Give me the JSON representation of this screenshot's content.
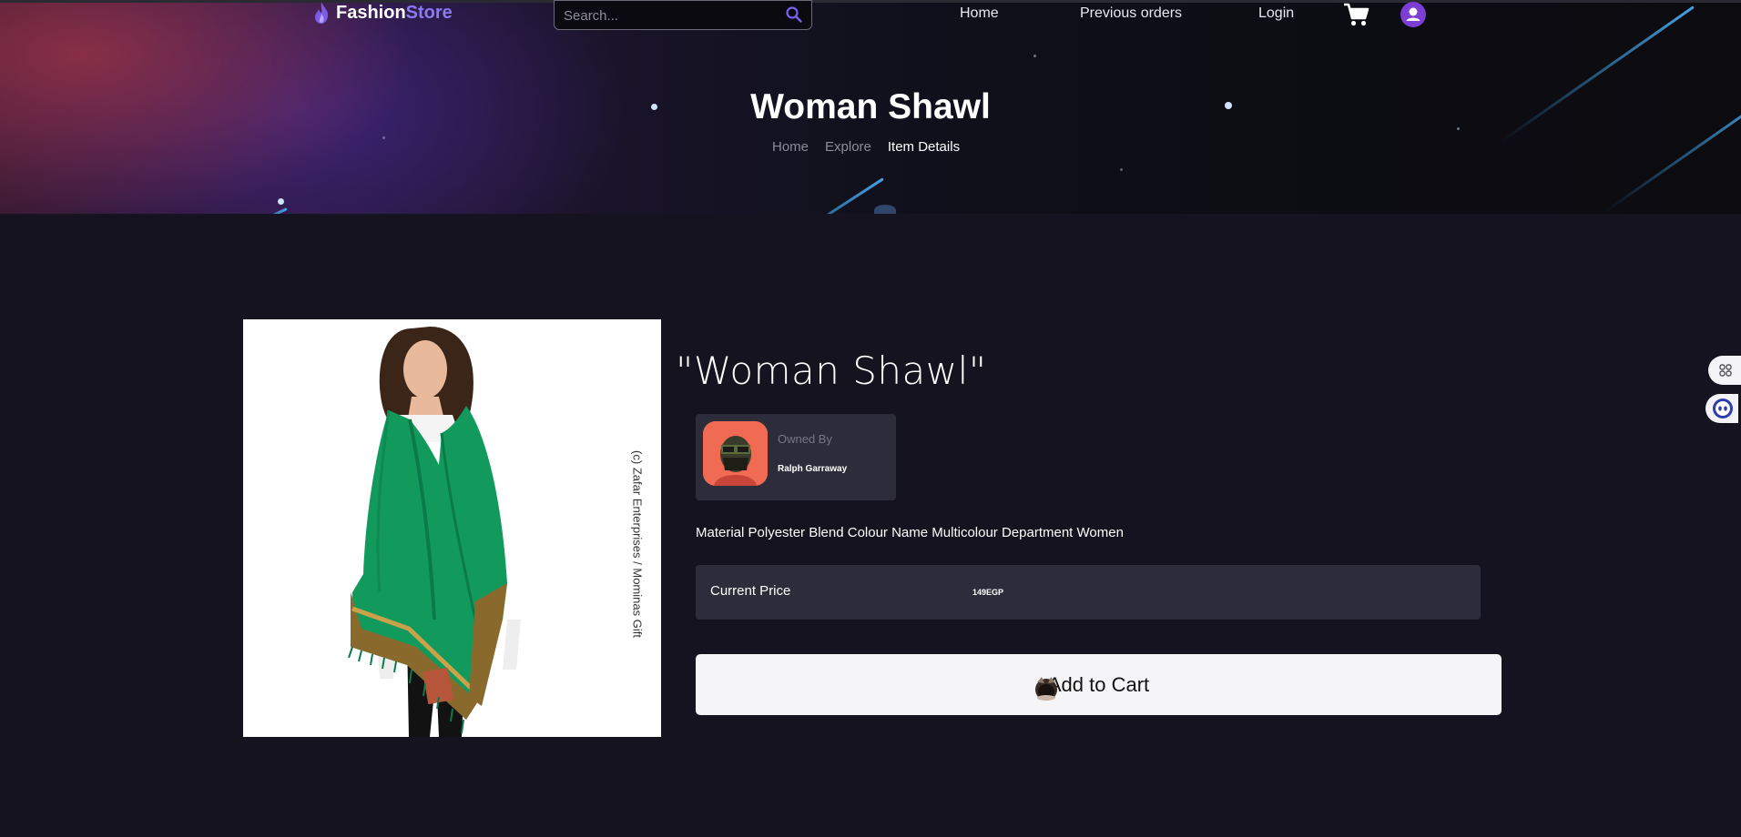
{
  "navbar": {
    "brand": {
      "part1": "Fashion",
      "part2": "Store"
    },
    "search": {
      "placeholder": "Search..."
    },
    "links": {
      "home": "Home",
      "previous_orders": "Previous orders",
      "login": "Login"
    }
  },
  "hero": {
    "title": "Woman Shawl",
    "breadcrumb": [
      "Home",
      "Explore",
      "Item Details"
    ]
  },
  "product": {
    "image_credit": "(c) Zafar Enterprises / Mominas Gift",
    "title": "\"Woman Shawl\"",
    "owner_label": "Owned By",
    "owner_name": "Ralph Garraway",
    "description": "Material Polyester Blend Colour Name Multicolour Department Women",
    "price_label": "Current Price",
    "price_value": "149EGP",
    "add_to_cart_label": "Add to Cart"
  },
  "colors": {
    "page_bg": "#14131f",
    "brand_accent": "#8a7cf0",
    "card_bg": "#2d2c3a",
    "shawl_green": "#129a5c",
    "avatar_purple": "#7d3ed6"
  },
  "icons": [
    "flame-icon",
    "search-icon",
    "cart-icon",
    "user-avatar-icon",
    "widget-icon",
    "assistant-icon"
  ]
}
